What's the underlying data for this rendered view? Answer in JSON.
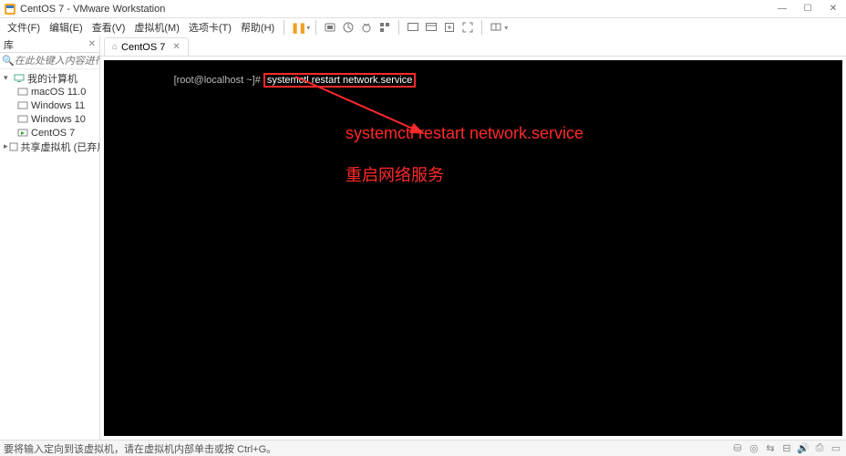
{
  "window": {
    "title": "CentOS 7 - VMware Workstation"
  },
  "menu": {
    "items": [
      "文件(F)",
      "编辑(E)",
      "查看(V)",
      "虚拟机(M)",
      "选项卡(T)",
      "帮助(H)"
    ]
  },
  "sidebar": {
    "title": "库",
    "search_placeholder": "在此处键入内容进行搜索",
    "root": "我的计算机",
    "vms": [
      "macOS 11.0",
      "Windows 11",
      "Windows 10",
      "CentOS 7"
    ],
    "shared": "共享虚拟机 (已弃用)"
  },
  "tab": {
    "label": "CentOS 7"
  },
  "terminal": {
    "prompt": "[root@localhost ~]#",
    "command": "systemctl restart network.service"
  },
  "annotation": {
    "line1": "systemctl restart network.service",
    "line2": "重启网络服务"
  },
  "statusbar": {
    "text": "要将输入定向到该虚拟机，请在虚拟机内部单击或按 Ctrl+G。"
  }
}
